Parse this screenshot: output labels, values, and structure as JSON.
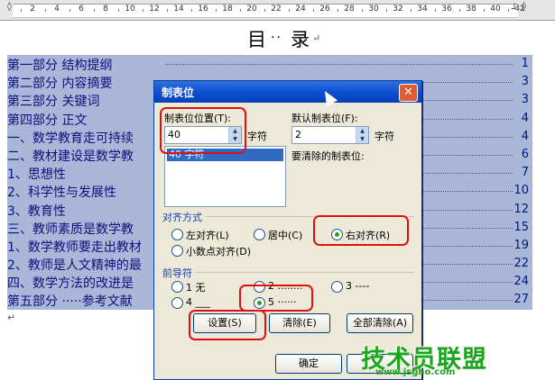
{
  "ruler": {
    "numbers": [
      "2",
      "4",
      "6",
      "8",
      "10",
      "12",
      "14",
      "16",
      "18",
      "20",
      "22",
      "24",
      "26",
      "28",
      "30",
      "32",
      "34",
      "36",
      "38",
      "40",
      "42"
    ]
  },
  "document": {
    "title_part1": "目",
    "title_dots": "··",
    "title_part2": "录",
    "paragraph_mark": "↵",
    "toc": [
      {
        "text": "第一部分   结构提纲",
        "page": "1"
      },
      {
        "text": "第二部分   内容摘要",
        "page": "3"
      },
      {
        "text": "第三部分   关键词",
        "page": "3"
      },
      {
        "text": "第四部分   正文",
        "page": "4"
      },
      {
        "text": "一、数学教育走可持续",
        "page": "4"
      },
      {
        "text": "二、教材建设是数学教",
        "page": "6"
      },
      {
        "text": "1、思想性",
        "page": "7"
      },
      {
        "text": "2、科学性与发展性",
        "page": "10"
      },
      {
        "text": "3、教育性",
        "page": "12"
      },
      {
        "text": "三、教师素质是数学教",
        "page": "15"
      },
      {
        "text": "1、数学教师要走出教材",
        "page": "19"
      },
      {
        "text": "2、教师是人文精神的最",
        "page": "22"
      },
      {
        "text": "四、数学方法的改进是",
        "page": "24"
      },
      {
        "text": "第五部分   ·····参考文献",
        "page": "27"
      }
    ]
  },
  "dialog": {
    "title": "制表位",
    "close_symbol": "✕",
    "tab_position_label": "制表位位置(T):",
    "tab_position_value": "40",
    "unit1": "字符",
    "default_tab_label": "默认制表位(F):",
    "default_tab_value": "2",
    "unit2": "字符",
    "tab_list_item": "40 字符",
    "clear_label": "要清除的制表位:",
    "alignment_group": "对齐方式",
    "align_left": "左对齐(L)",
    "align_center": "居中(C)",
    "align_right": "右对齐(R)",
    "align_decimal": "小数点对齐(D)",
    "leader_group": "前导符",
    "leader1": "1 无",
    "leader2": "2 ........",
    "leader3": "3 ----",
    "leader4": "4 ___",
    "leader5": "5 ······",
    "set_button": "设置(S)",
    "clear_button": "清除(E)",
    "clear_all_button": "全部清除(A)",
    "ok_button": "确定"
  },
  "watermark": {
    "text": "技术员联盟",
    "url": "www.jsgho.com"
  }
}
